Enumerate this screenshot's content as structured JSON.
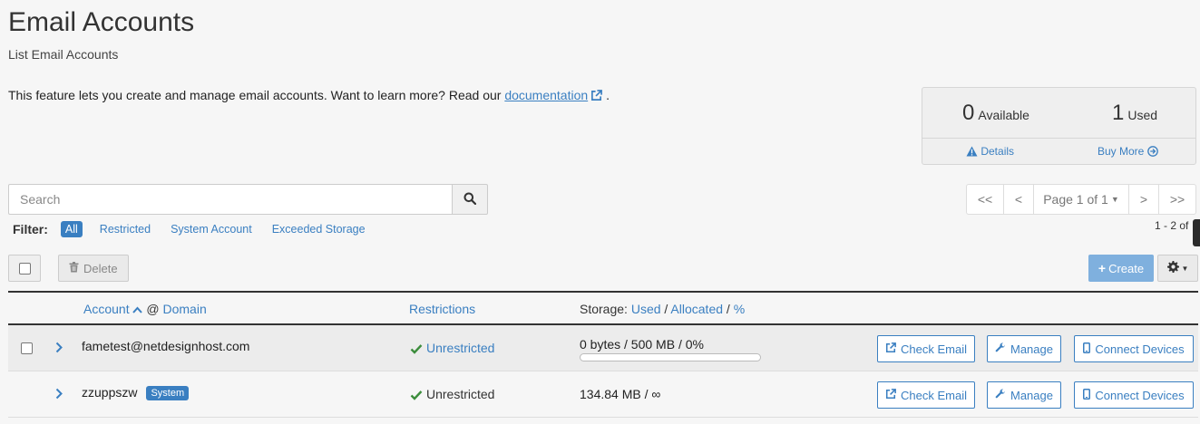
{
  "header": {
    "title": "Email Accounts",
    "subtitle": "List Email Accounts",
    "intro_text": "This feature lets you create and manage email accounts. Want to learn more? Read our ",
    "intro_link": "documentation",
    "intro_end": "."
  },
  "stats": {
    "available_count": "0",
    "available_label": "Available",
    "used_count": "1",
    "used_label": "Used",
    "details_link": "Details",
    "buy_more_link": "Buy More"
  },
  "search": {
    "placeholder": "Search"
  },
  "pagination": {
    "first": "<<",
    "prev": "<",
    "page_label": "Page 1 of 1",
    "next": ">",
    "last": ">>",
    "range_text": "1 - 2 of"
  },
  "filter": {
    "label": "Filter:",
    "options": [
      "All",
      "Restricted",
      "System Account",
      "Exceeded Storage"
    ],
    "active": "All"
  },
  "toolbar": {
    "delete_label": "Delete",
    "create_label": "Create"
  },
  "table": {
    "headers": {
      "account": "Account",
      "at": "@",
      "domain": "Domain",
      "restrictions": "Restrictions",
      "storage_prefix": "Storage:",
      "used": "Used",
      "allocated": "Allocated",
      "percent": "%"
    },
    "rows": [
      {
        "account": "fametest@netdesignhost.com",
        "badge": "",
        "restriction": "Unrestricted",
        "storage": "0 bytes / 500 MB / 0%",
        "usage_fraction": 0,
        "actions": [
          "Check Email",
          "Manage",
          "Connect Devices"
        ]
      },
      {
        "account": "zzuppszw",
        "badge": "System",
        "restriction": "Unrestricted",
        "storage": "134.84 MB / ∞",
        "actions": [
          "Check Email",
          "Manage",
          "Connect Devices"
        ]
      }
    ]
  },
  "colors": {
    "accent": "#3a7fc1",
    "success": "#3c8d3c",
    "create_button": "#7fb0de"
  }
}
